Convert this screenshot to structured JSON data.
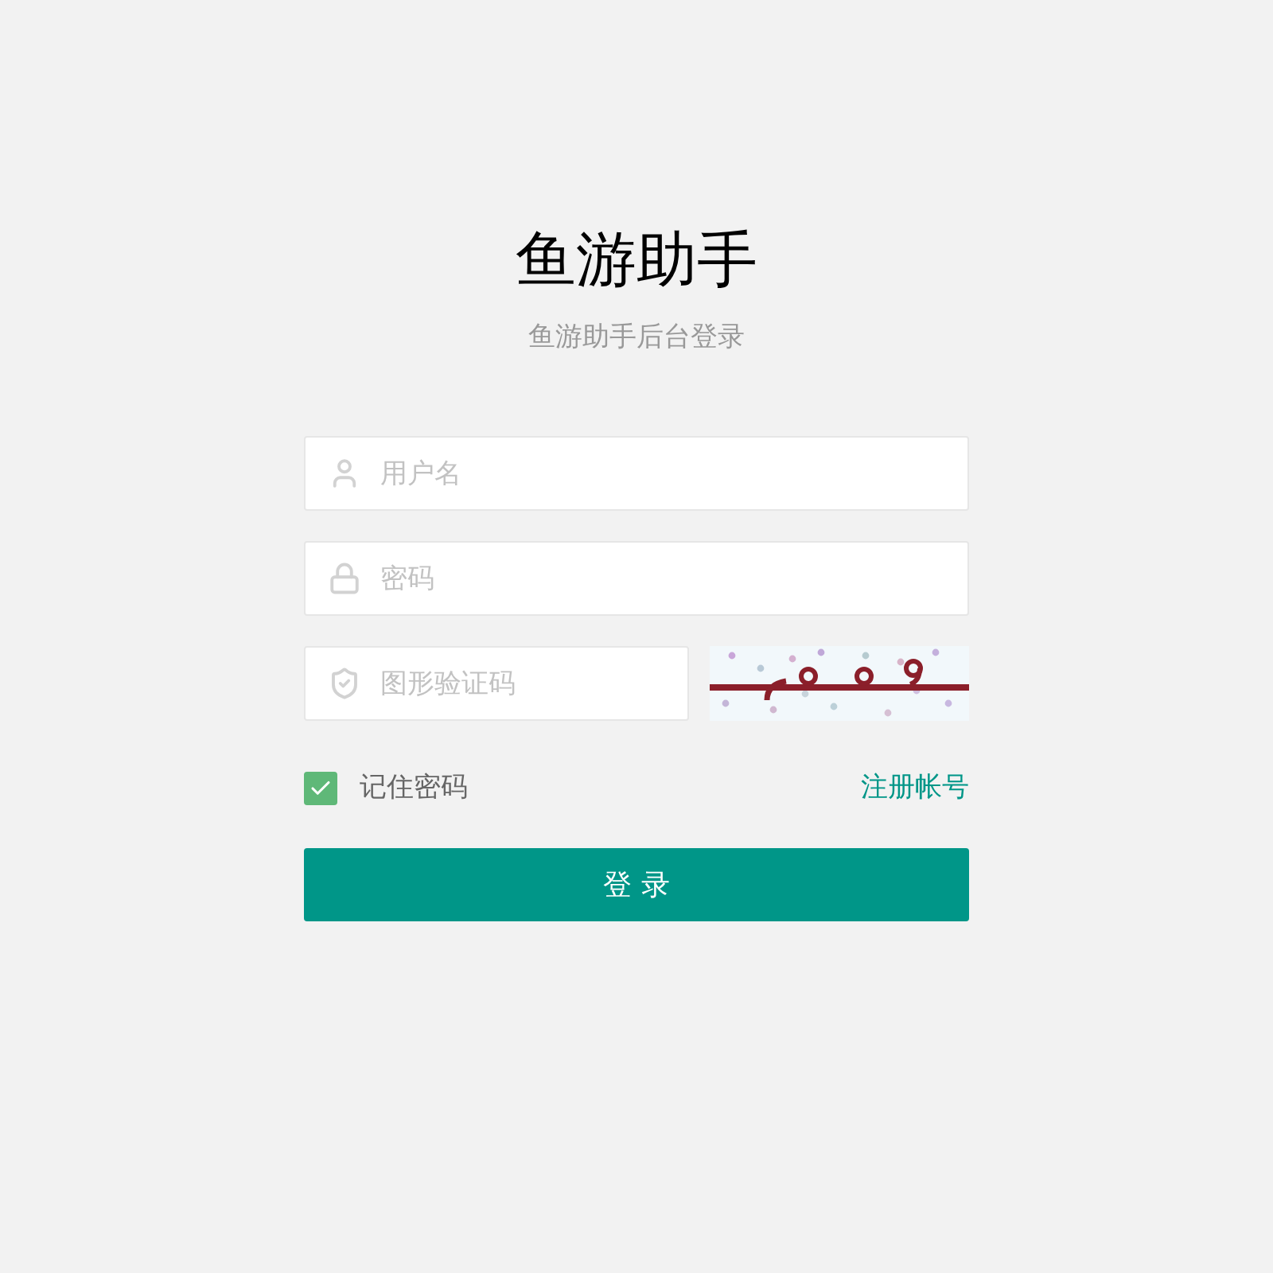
{
  "header": {
    "title": "鱼游助手",
    "subtitle": "鱼游助手后台登录"
  },
  "fields": [
    {
      "kind": "username",
      "placeholder": "用户名"
    },
    {
      "kind": "password",
      "placeholder": "密码"
    },
    {
      "kind": "captcha",
      "placeholder": "图形验证码"
    }
  ],
  "remember": {
    "label": "记住密码",
    "checked": true
  },
  "register_link": "注册帐号",
  "submit": "登 录"
}
